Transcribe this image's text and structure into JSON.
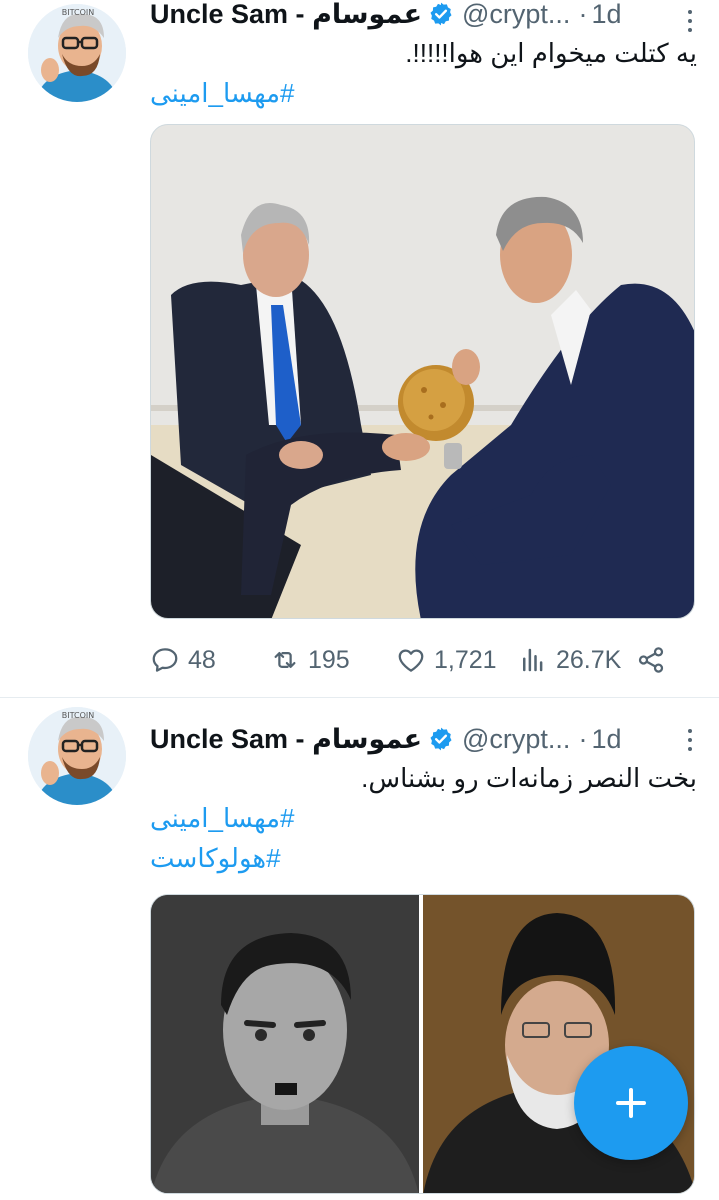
{
  "tweets": [
    {
      "author": {
        "display_name": "Uncle Sam - عموسام",
        "handle": "@crypt...",
        "verified": true,
        "avatar_text": "BITCOIN"
      },
      "separator": "·",
      "time": "1d",
      "text": "یه کتلت میخوام این هوا!!!!!.",
      "hashtags": [
        "#مهسا_امینی"
      ],
      "media": {
        "type": "photo",
        "description_icon": "photo"
      },
      "stats": {
        "replies": "48",
        "retweets": "195",
        "likes": "1,721",
        "views": "26.7K"
      }
    },
    {
      "author": {
        "display_name": "Uncle Sam - عموسام",
        "handle": "@crypt...",
        "verified": true,
        "avatar_text": "BITCOIN"
      },
      "separator": "·",
      "time": "1d",
      "text": "بخت النصر زمانه‌ات رو بشناس.",
      "hashtags": [
        "#مهسا_امینی",
        "#هولوکاست"
      ],
      "media": {
        "type": "photo-grid",
        "count": 2
      }
    }
  ],
  "fab": {
    "icon": "plus-icon"
  },
  "colors": {
    "accent": "#1d9bf0",
    "muted": "#536471",
    "text": "#0f1419",
    "divider": "#e6ecf0"
  }
}
